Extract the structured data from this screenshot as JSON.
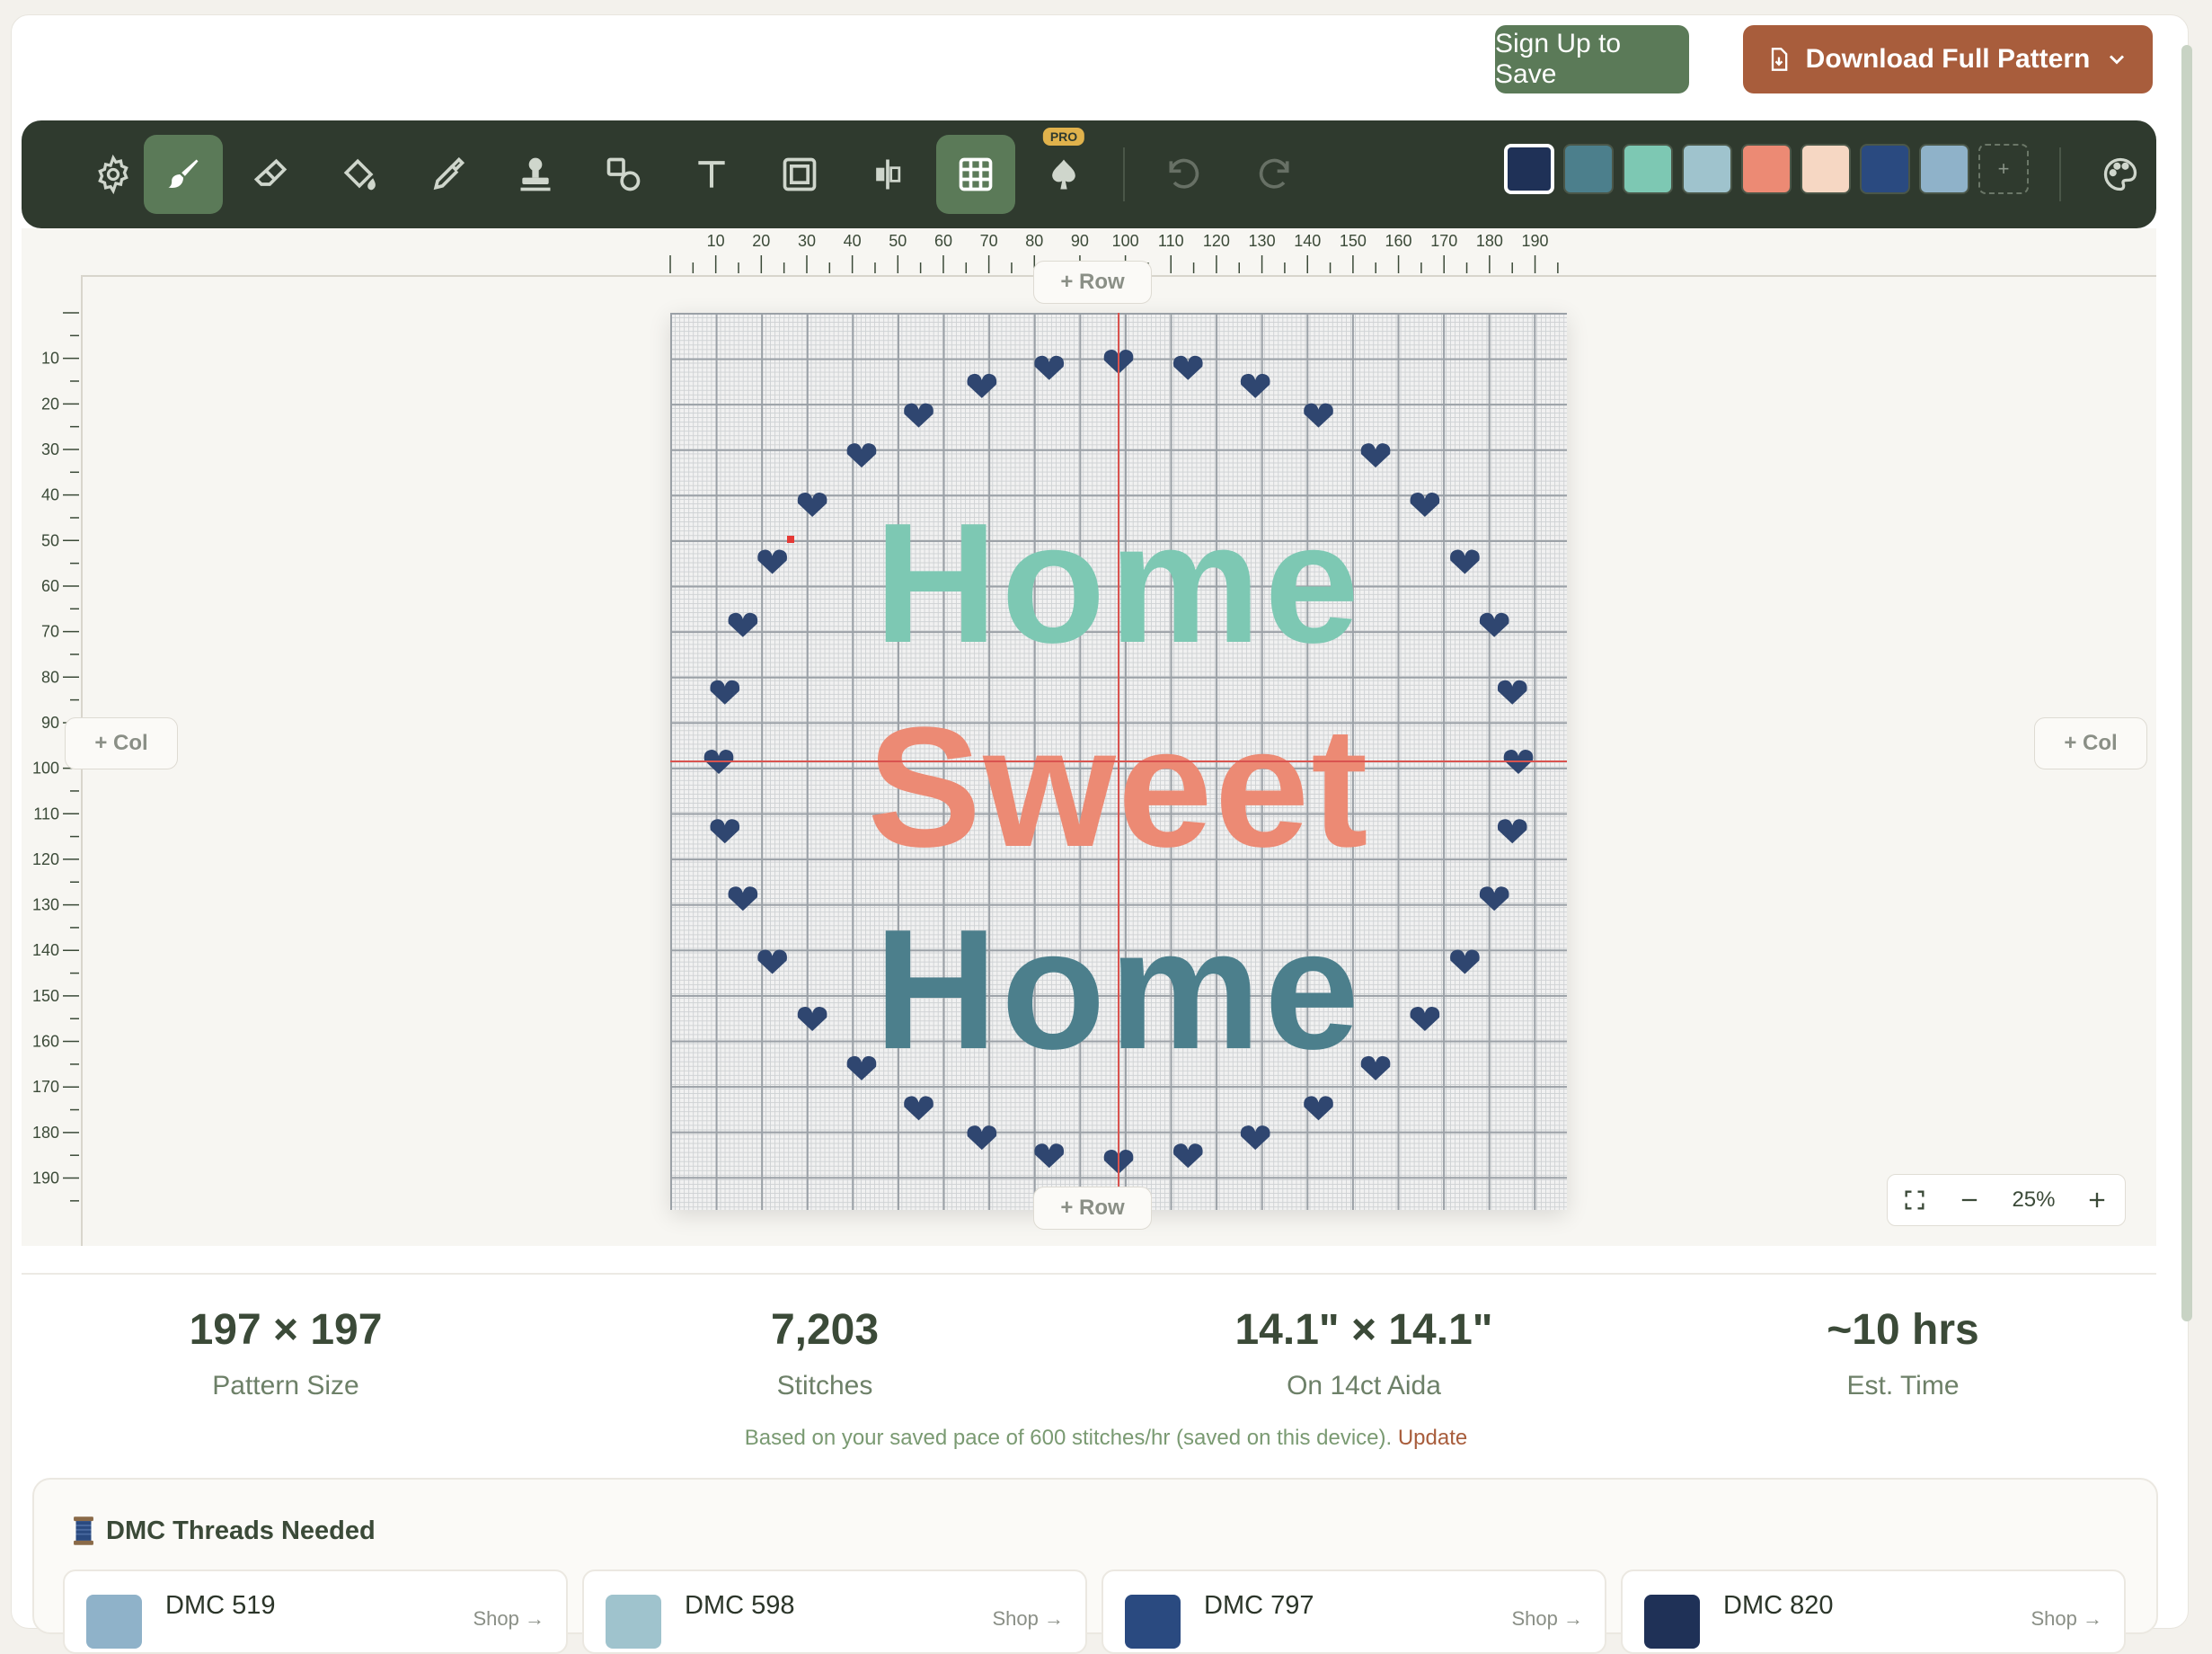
{
  "header": {
    "signup_label": "Sign Up to Save",
    "download_label": "Download Full Pattern"
  },
  "toolbar": {
    "tools": [
      {
        "name": "settings-icon"
      },
      {
        "name": "brush-icon",
        "active": true
      },
      {
        "name": "eraser-icon"
      },
      {
        "name": "paint-bucket-icon"
      },
      {
        "name": "eyedropper-icon"
      },
      {
        "name": "stamp-icon"
      },
      {
        "name": "shapes-icon"
      },
      {
        "name": "text-icon"
      },
      {
        "name": "frame-icon"
      },
      {
        "name": "mirror-icon"
      },
      {
        "name": "grid-icon",
        "active": true
      },
      {
        "name": "spade-icon",
        "badge": "PRO"
      },
      {
        "name": "undo-icon"
      },
      {
        "name": "redo-icon"
      }
    ],
    "pro_badge": "PRO",
    "palette": [
      "#1f3157",
      "#4c7f8c",
      "#7dc8b3",
      "#9fc3cd",
      "#ec8a74",
      "#f6d7c3",
      "#2a4a80",
      "#8fb2c9"
    ],
    "add_swatch": "+",
    "palette_icon": "palette-icon"
  },
  "rulers": {
    "top": [
      "10",
      "20",
      "30",
      "40",
      "50",
      "60",
      "70",
      "80",
      "90",
      "100",
      "110",
      "120",
      "130",
      "140",
      "150",
      "160",
      "170",
      "180",
      "190"
    ],
    "left": [
      "10",
      "20",
      "30",
      "40",
      "50",
      "60",
      "70",
      "80",
      "90",
      "100",
      "110",
      "120",
      "130",
      "140",
      "150",
      "160",
      "170",
      "180",
      "190"
    ]
  },
  "canvas": {
    "add_row_top": "+ Row",
    "add_row_bottom": "+ Row",
    "add_col_left": "+ Col",
    "add_col_right": "+ Col",
    "pattern_lines": [
      "Home",
      "Sweet",
      "Home"
    ],
    "zoom_level": "25%"
  },
  "stats": [
    {
      "value": "197 × 197",
      "label": "Pattern Size"
    },
    {
      "value": "7,203",
      "label": "Stitches"
    },
    {
      "value": "14.1\" × 14.1\"",
      "label": "On 14ct Aida"
    },
    {
      "value": "~10 hrs",
      "label": "Est. Time"
    }
  ],
  "pace": {
    "text": "Based on your saved pace of 600 stitches/hr (saved on this device).",
    "link": "Update"
  },
  "threads": {
    "title": "DMC Threads Needed",
    "items": [
      {
        "name": "DMC 519",
        "color": "#8fb2c9",
        "shop": "Shop →"
      },
      {
        "name": "DMC 598",
        "color": "#9fc3cd",
        "shop": "Shop →"
      },
      {
        "name": "DMC 797",
        "color": "#2a4a80",
        "shop": "Shop →"
      },
      {
        "name": "DMC 820",
        "color": "#1f3157",
        "shop": "Shop →"
      }
    ]
  }
}
